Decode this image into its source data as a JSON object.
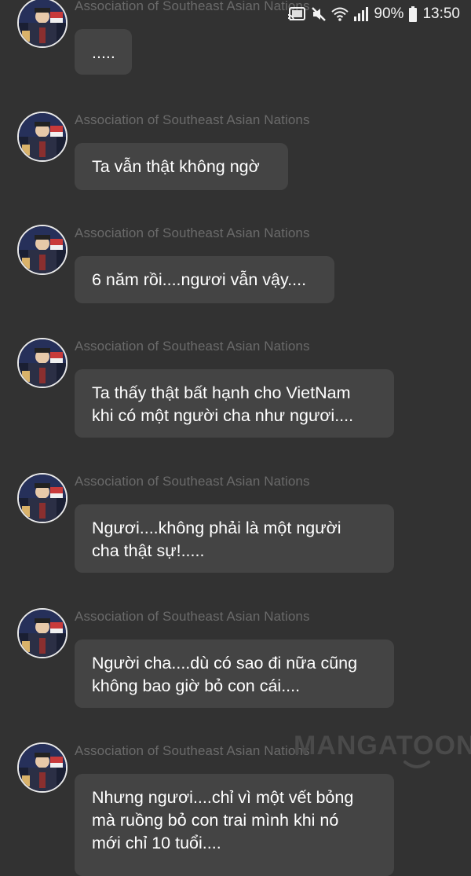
{
  "status_bar": {
    "battery": "90%",
    "time": "13:50",
    "icons": [
      "cast-icon",
      "mute-icon",
      "wifi-icon",
      "signal-icon",
      "battery-icon"
    ]
  },
  "colors": {
    "background": "#323232",
    "bubble": "#444444",
    "sender": "#6a6a6a",
    "text": "#ffffff"
  },
  "watermark": "MANGATOON",
  "messages": [
    {
      "sender": "Association of Southeast Asian Nations",
      "lines": [
        "....."
      ]
    },
    {
      "sender": "Association of Southeast Asian Nations",
      "lines": [
        "Ta vẫn thật không ngờ"
      ]
    },
    {
      "sender": "Association of Southeast Asian Nations",
      "lines": [
        "6 năm rồi....ngươi vẫn vậy...."
      ]
    },
    {
      "sender": "Association of Southeast Asian Nations",
      "lines": [
        "Ta thấy thật bất hạnh cho VietNam",
        "khi có một người cha như ngươi...."
      ]
    },
    {
      "sender": "Association of Southeast Asian Nations",
      "lines": [
        "Ngươi....không phải là một người",
        "cha thật sự!....."
      ]
    },
    {
      "sender": "Association of Southeast Asian Nations",
      "lines": [
        "Người cha....dù có sao đi nữa cũng",
        "không bao giờ bỏ con cái...."
      ]
    },
    {
      "sender": "Association of Southeast Asian Nations",
      "lines": [
        "Nhưng ngươi....chỉ vì một vết bỏng",
        "mà ruồng bỏ con trai mình khi nó",
        "mới chỉ 10 tuổi...."
      ]
    }
  ]
}
